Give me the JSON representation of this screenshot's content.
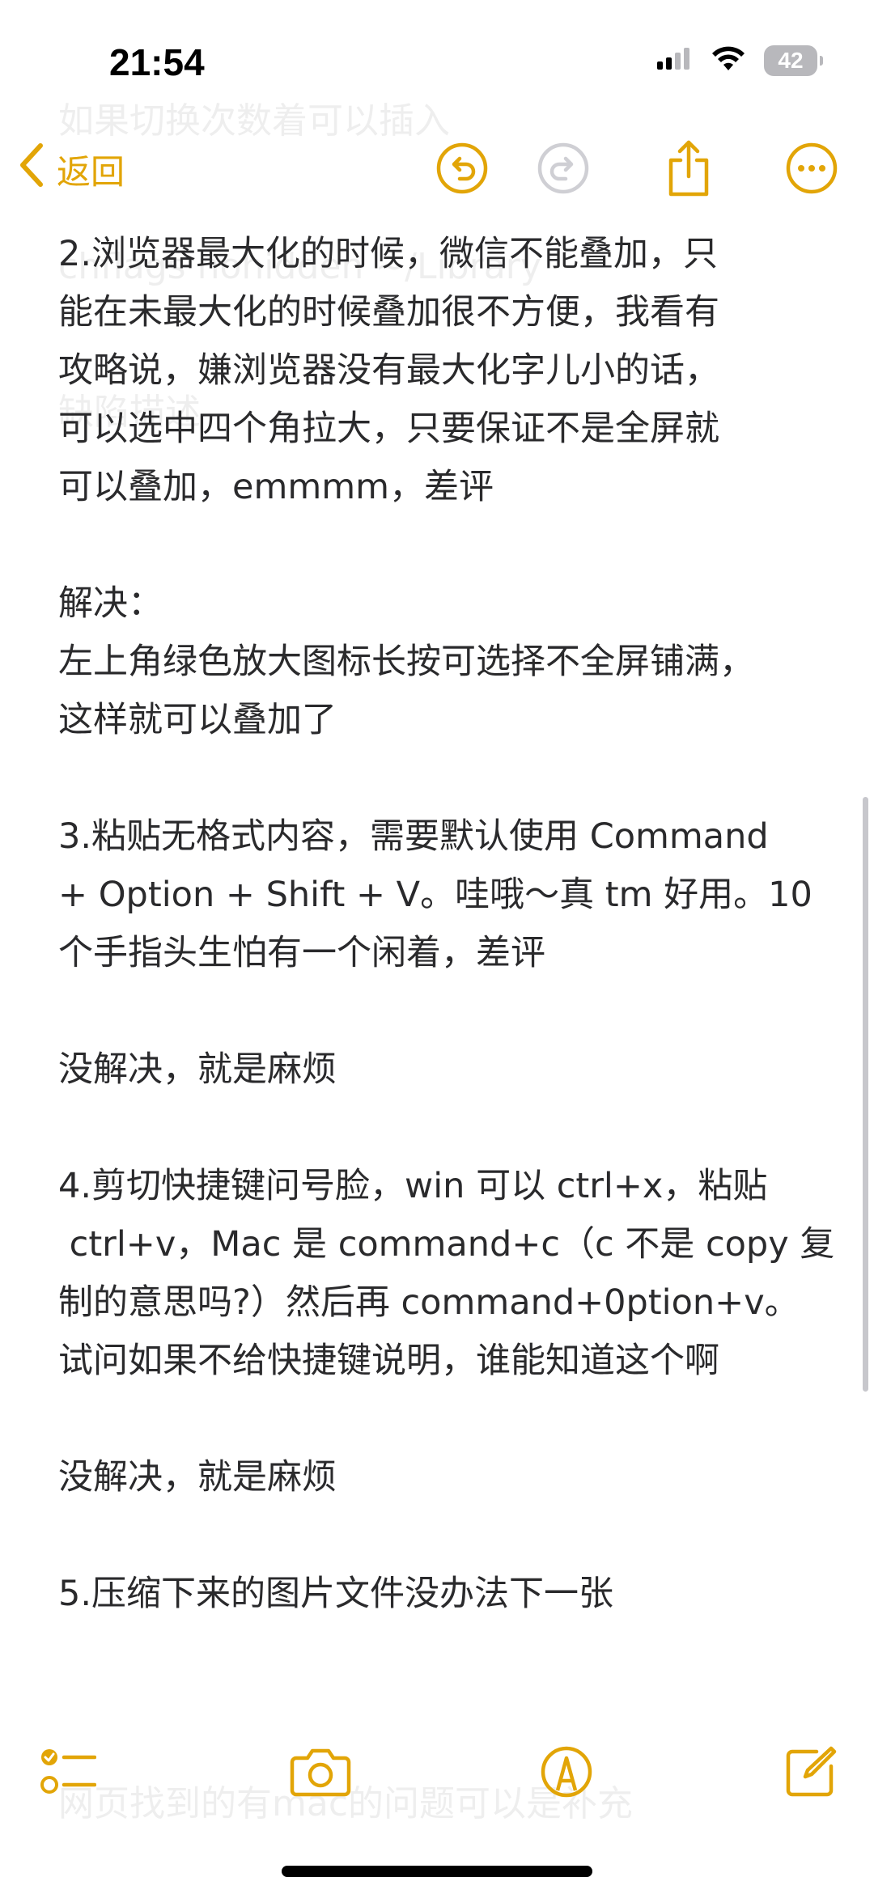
{
  "status_bar": {
    "time": "21:54",
    "battery_level": "42",
    "icons": [
      "signal-icon",
      "wifi-icon",
      "battery-icon"
    ]
  },
  "ghost": {
    "lines": [
      "如果切换次数着可以插入",
      "chflags nohidden ~/Library",
      "缺陷描述"
    ],
    "bottom": "网页找到的有mac的问题可以是补充"
  },
  "nav": {
    "back_label": "返回",
    "accent_color": "#e2a507",
    "disabled_color": "#cfcfd4"
  },
  "note": {
    "lines": [
      "2.浏览器最大化的时候，微信不能叠加，只",
      "能在未最大化的时候叠加很不方便，我看有",
      "攻略说，嫌浏览器没有最大化字儿小的话，",
      "可以选中四个角拉大，只要保证不是全屏就",
      "可以叠加，emmmm，差评",
      "",
      "解决：",
      "左上角绿色放大图标长按可选择不全屏铺满，",
      "这样就可以叠加了",
      "",
      "3.粘贴无格式内容，需要默认使用 Command",
      "+ Option + Shift + V。哇哦～真 tm 好用。10",
      "个手指头生怕有一个闲着，差评",
      "",
      "没解决，就是麻烦",
      "",
      "4.剪切快捷键问号脸，win 可以 ctrl+x，粘贴",
      " ctrl+v，Mac 是 command+c（c 不是 copy 复",
      "制的意思吗?）然后再 command+0ption+v。",
      "试问如果不给快捷键说明，谁能知道这个啊",
      "",
      "没解决，就是麻烦",
      "",
      "5.压缩下来的图片文件没办法下一张"
    ]
  },
  "toolbar": {
    "items": [
      "checklist-icon",
      "camera-icon",
      "markup-pen-icon",
      "compose-icon"
    ]
  }
}
